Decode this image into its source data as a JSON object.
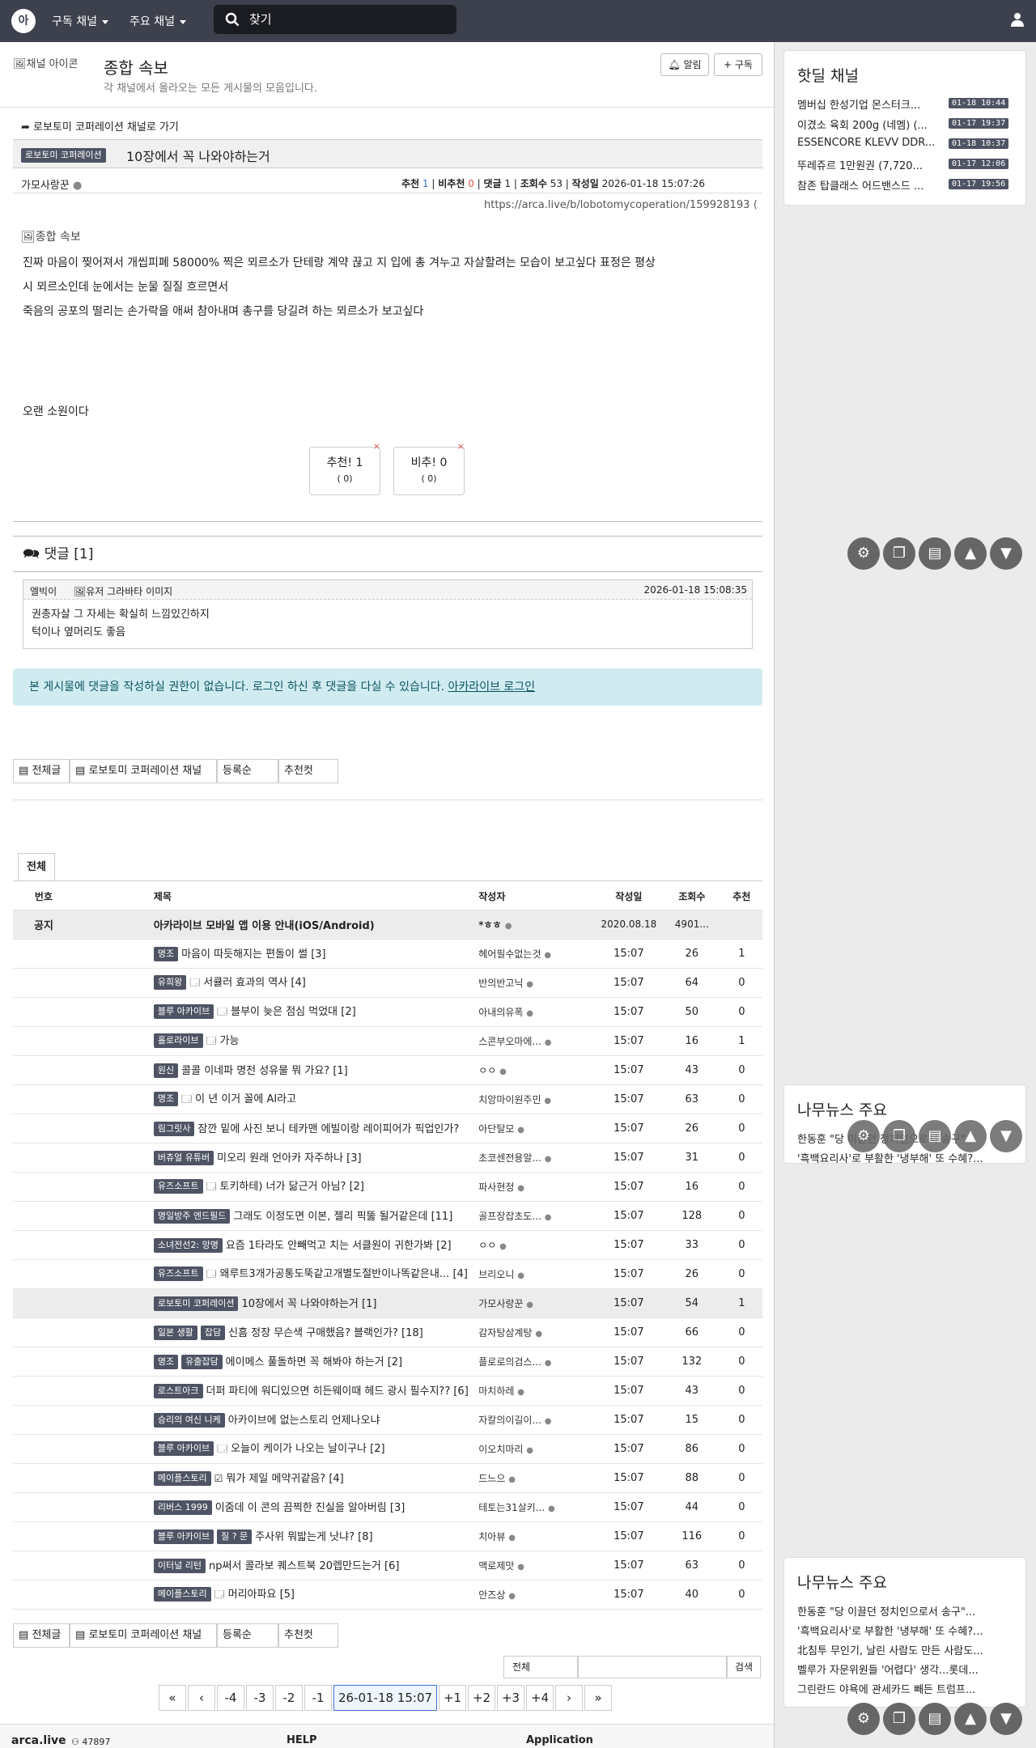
{
  "topbar": {
    "logo": "아",
    "nav1": "구독 채널",
    "nav2": "주요 채널",
    "search_placeholder": "찾기"
  },
  "header": {
    "channel_icon_alt": "채널 아이콘",
    "title": "종합 속보",
    "subtitle": "각 채널에서 올라오는 모든 게시물의 모음입니다.",
    "alarm": "알림",
    "subscribe": "구독"
  },
  "article": {
    "goto_channel": "로보토미 코퍼레이션 채널로 가기",
    "category": "로보토미 코퍼레이션",
    "title": "10장에서 꼭 나와야하는거",
    "author": "가모사랑꾼",
    "stats": {
      "rec_label": "추천",
      "rec": "1",
      "unrec_label": "비추천",
      "unrec": "0",
      "comment_label": "댓글",
      "comment": "1",
      "views_label": "조회수",
      "views": "53",
      "date_label": "작성일",
      "date": "2026-01-18 15:07:26"
    },
    "url": "https://arca.live/b/lobotomycoperation/159928193",
    "image_alt": "종합 속보",
    "body1": "진짜 마음이 찢어져서 개씹피폐 58000% 찍은 뫼르소가 단테랑 계약 끊고 지 입에 총 겨누고 자살할려는 모습이 보고싶다 표정은 평상",
    "body2": "시 뫼르소인데 눈에서는 눈물 질질 흐르면서",
    "body3": "죽음의 공포의 떨리는 손가락을 애써 참아내며 총구를 당길려 하는 뫼르소가 보고싶다",
    "body4": "오랜 소원이다",
    "vote_up": "추천! 1",
    "vote_up_sub": "( 0)",
    "vote_down": "비추! 0",
    "vote_down_sub": "( 0)"
  },
  "comments": {
    "header": "댓글 [1]",
    "author": "엘빅이",
    "avatar_alt": "유저 그라바타 이미지",
    "date": "2026-01-18 15:08:35",
    "line1": "권총자살 그 자세는 확실히 느낌있긴하지",
    "line2": "턱이나 옆머리도 좋음",
    "login_notice": "본 게시물에 댓글을 작성하실 권한이 없습니다. 로그인 하신 후 댓글을 다실 수 있습니다.",
    "login_link": "아카라이브 로그인"
  },
  "board_tabs": {
    "all": "전체글",
    "channel": "로보토미 코퍼레이션 채널",
    "order": "등록순",
    "best": "추천컷"
  },
  "list_tab": "전체",
  "list_headers": {
    "no": "번호",
    "title": "제목",
    "author": "작성자",
    "date": "작성일",
    "views": "조회수",
    "rec": "추천"
  },
  "notice": {
    "no": "공지",
    "title": "아카라이브 모바일 앱 이용 안내(iOS/Android)",
    "author": "*ㅎㅎ",
    "date": "2020.08.18",
    "views": "4901...",
    "rec": ""
  },
  "rows": [
    {
      "badges": [
        "명조"
      ],
      "icon": "",
      "title": "마음이 따듯해지는 편돌이 썰",
      "cmt": "[3]",
      "author": "헤어필수없는것",
      "date": "15:07",
      "views": "26",
      "rec": "1",
      "hl": false
    },
    {
      "badges": [
        "유희왕"
      ],
      "icon": "🗔",
      "title": "서큘러 효과의 역사",
      "cmt": "[4]",
      "author": "반의반고닉",
      "date": "15:07",
      "views": "64",
      "rec": "0",
      "hl": false
    },
    {
      "badges": [
        "블루 아카이브"
      ],
      "icon": "🗔",
      "title": "블부이 늦은 점심 먹었대",
      "cmt": "[2]",
      "author": "아내의유폭",
      "date": "15:07",
      "views": "50",
      "rec": "0",
      "hl": false
    },
    {
      "badges": [
        "홀로라이브"
      ],
      "icon": "🗔",
      "title": "가능",
      "cmt": "",
      "author": "스콘부오마에...",
      "date": "15:07",
      "views": "16",
      "rec": "1",
      "hl": false
    },
    {
      "badges": [
        "원신"
      ],
      "icon": "",
      "title": "콜콜 이네파 명전 성유물 뭐 가요?",
      "cmt": "[1]",
      "author": "ㅇㅇ",
      "date": "15:07",
      "views": "43",
      "rec": "0",
      "hl": false
    },
    {
      "badges": [
        "명조"
      ],
      "icon": "🗔",
      "title": "이 년 이거 꼴에 AI라고",
      "cmt": "",
      "author": "치앙마이원주민",
      "date": "15:07",
      "views": "63",
      "rec": "0",
      "hl": false
    },
    {
      "badges": [
        "림그릿사"
      ],
      "icon": "",
      "title": "잠깐 밑에 사진 보니 테카맨 에빌이랑 레이피어가 픽업인가?",
      "cmt": "",
      "author": "아단탈모",
      "date": "15:07",
      "views": "26",
      "rec": "0",
      "hl": false
    },
    {
      "badges": [
        "버츄얼 유튜버"
      ],
      "icon": "",
      "title": "미오리 원래 언아카 자주하나",
      "cmt": "[3]",
      "author": "초코센전용알...",
      "date": "15:07",
      "views": "31",
      "rec": "0",
      "hl": false
    },
    {
      "badges": [
        "유즈소프트"
      ],
      "icon": "🗔",
      "title": "토키하테) 너가 닮근거 아님?",
      "cmt": "[2]",
      "author": "파사현정",
      "date": "15:07",
      "views": "16",
      "rec": "0",
      "hl": false
    },
    {
      "badges": [
        "명일방주 엔드필드"
      ],
      "icon": "",
      "title": "그래도 이정도면 이본, 젤리 픽뚫 될거같은데",
      "cmt": "[11]",
      "author": "골프장잡초도...",
      "date": "15:07",
      "views": "128",
      "rec": "0",
      "hl": false
    },
    {
      "badges": [
        "소녀전선2: 망명"
      ],
      "icon": "",
      "title": "요즘 1타라도 안빼먹고 치는 서클원이 귀한가봐",
      "cmt": "[2]",
      "author": "ㅇㅇ",
      "date": "15:07",
      "views": "33",
      "rec": "0",
      "hl": false
    },
    {
      "badges": [
        "유즈소프트"
      ],
      "icon": "🗔",
      "title": "왜루트3개가공통도뚝같고개별도절반이나똑같은내...",
      "cmt": "[4]",
      "author": "브리오니",
      "date": "15:07",
      "views": "26",
      "rec": "0",
      "hl": false
    },
    {
      "badges": [
        "로보토미 코퍼레이션"
      ],
      "icon": "",
      "title": "10장에서 꼭 나와야하는거",
      "cmt": "[1]",
      "author": "가모사랑꾼",
      "date": "15:07",
      "views": "54",
      "rec": "1",
      "hl": true
    },
    {
      "badges": [
        "일본 생활",
        "잡담"
      ],
      "icon": "",
      "title": "신흠 정장 무슨색 구매했음? 블랙인가?",
      "cmt": "[18]",
      "author": "감자탕삼계탕",
      "date": "15:07",
      "views": "66",
      "rec": "0",
      "hl": false
    },
    {
      "badges": [
        "명조",
        "유출잡담"
      ],
      "icon": "",
      "title": "에이메스 풀돌하면 꼭 해봐야 하는거",
      "cmt": "[2]",
      "author": "플로로의검스...",
      "date": "15:07",
      "views": "132",
      "rec": "0",
      "hl": false
    },
    {
      "badges": [
        "로스트아크"
      ],
      "icon": "",
      "title": "더퍼 파티에 워디있으면 히든웨이때 헤드 광시 필수지??",
      "cmt": "[6]",
      "author": "마치하레",
      "date": "15:07",
      "views": "43",
      "rec": "0",
      "hl": false
    },
    {
      "badges": [
        "승리의 여신 니케"
      ],
      "icon": "",
      "title": "아카이브에 없는스토리 언제나오냐",
      "cmt": "",
      "author": "자칼의이길이...",
      "date": "15:07",
      "views": "15",
      "rec": "0",
      "hl": false
    },
    {
      "badges": [
        "블루 아카이브"
      ],
      "icon": "🗔",
      "title": "오늘이 케이가 나오는 날이구나",
      "cmt": "[2]",
      "author": "이오치마리",
      "date": "15:07",
      "views": "86",
      "rec": "0",
      "hl": false
    },
    {
      "badges": [
        "메이플스토리"
      ],
      "icon": "☑",
      "title": "뭐가 제일 메약귀같음?",
      "cmt": "[4]",
      "author": "드느으",
      "date": "15:07",
      "views": "88",
      "rec": "0",
      "hl": false
    },
    {
      "badges": [
        "리버스 1999"
      ],
      "icon": "",
      "title": "이줌데 이 콘의 끔찍한 진실을 알아버림",
      "cmt": "[3]",
      "author": "테토는31살키...",
      "date": "15:07",
      "views": "44",
      "rec": "0",
      "hl": false
    },
    {
      "badges": [
        "블루 아카이브",
        "질 ? 문"
      ],
      "icon": "",
      "title": "주사위 뭐밟는게 낫냐?",
      "cmt": "[8]",
      "author": "치아뷰",
      "date": "15:07",
      "views": "116",
      "rec": "0",
      "hl": false
    },
    {
      "badges": [
        "이터널 리턴"
      ],
      "icon": "",
      "title": "np써서 콜라보 퀘스트북 20렙만드는거",
      "cmt": "[6]",
      "author": "맥로제맛",
      "date": "15:07",
      "views": "63",
      "rec": "0",
      "hl": false
    },
    {
      "badges": [
        "메이플스토리"
      ],
      "icon": "🗔",
      "title": "머리아파요",
      "cmt": "[5]",
      "author": "안즈상",
      "date": "15:07",
      "views": "40",
      "rec": "0",
      "hl": false
    }
  ],
  "bottom_search": {
    "select": "전체",
    "button": "검색"
  },
  "pagination": [
    "«",
    "‹",
    "-4",
    "-3",
    "-2",
    "-1",
    "26-01-18 15:07",
    "+1",
    "+2",
    "+3",
    "+4",
    "›",
    "»"
  ],
  "hotdeal": {
    "title": "핫딜 채널",
    "items": [
      {
        "text": "멤버십 한성기업 몬스터크...",
        "date": "01-18 10:44"
      },
      {
        "text": "이겼소 육회 200g (네멤) (...",
        "date": "01-17 19:37"
      },
      {
        "text": "ESSENCORE KLEVV DDR...",
        "date": "01-18 10:37"
      },
      {
        "text": "뚜레쥬르 1만원권 (7,720...",
        "date": "01-17 12:06"
      },
      {
        "text": "참존 탑클래스 어드밴스드 ...",
        "date": "01-17 19:56"
      }
    ]
  },
  "namunews1": {
    "title": "나무뉴스 주요",
    "items": [
      "한동훈 \"당 이끌던 정치인으로서 송구\"...",
      "'흑백요리사'로 부활한 '냉부해' 또 수혜?..."
    ]
  },
  "namunews2": {
    "title": "나무뉴스 주요",
    "items": [
      "한동훈 \"당 이끌던 정치인으로서 송구\"...",
      "'흑백요리사'로 부활한 '냉부해' 또 수혜?...",
      "北침투 무인기, 날린 사람도 만든 사람도...",
      "벨루가 자문위원들 '어렵다' 생각...롯데...",
      "그린란드 야욕에 관세카드 빼든 트럼프..."
    ]
  },
  "footer": {
    "brand": "arca.live",
    "count": "47897",
    "help": "HELP",
    "app": "Application"
  },
  "colors": {
    "topbar": "#3d414d",
    "badge": "#4f5464",
    "notice_bg": "#d1ecf1",
    "rec_blue": "#3b73d6",
    "unrec_red": "#d9534f"
  }
}
